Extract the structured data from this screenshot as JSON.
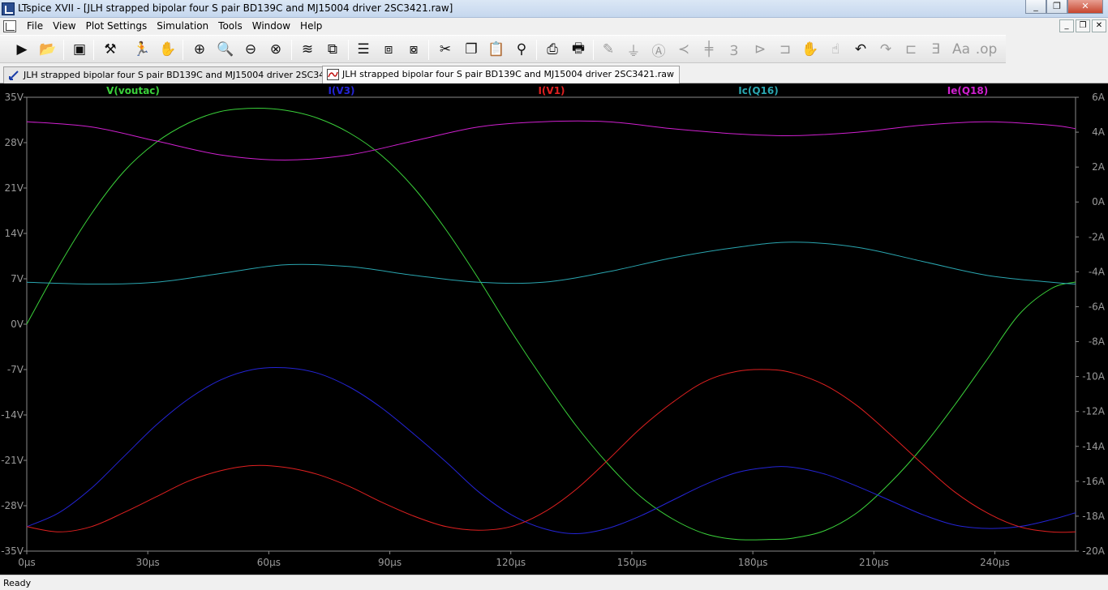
{
  "window": {
    "title": "LTspice XVII - [JLH strapped bipolar four S pair BD139C and  MJ15004 driver 2SC3421.raw]",
    "buttons": [
      "_",
      "❐",
      "✕"
    ]
  },
  "menu": {
    "items": [
      "File",
      "View",
      "Plot Settings",
      "Simulation",
      "Tools",
      "Window",
      "Help"
    ],
    "mdi_buttons": [
      "_",
      "❐",
      "✕"
    ]
  },
  "toolbar": {
    "icons": [
      "run-icon",
      "open-icon",
      "save-icon",
      "control-panel-icon",
      "run-man-icon",
      "pan-hand-icon",
      "zoom-in-icon",
      "zoom-fit-icon",
      "zoom-out-icon",
      "zoom-cancel-icon",
      "autorange-icon",
      "plot-traces-icon",
      "tile-horizontal-icon",
      "cascade-icon",
      "tile-vertical-icon",
      "cut-icon",
      "copy-icon",
      "paste-icon",
      "find-icon",
      "print-icon",
      "print-setup-icon",
      "wire-icon",
      "ground-icon",
      "label-icon",
      "resistor-icon",
      "capacitor-icon",
      "inductor-icon",
      "diode-icon",
      "component-icon",
      "move-icon",
      "drag-icon",
      "undo-icon",
      "redo-icon",
      "rotate-icon",
      "mirror-icon",
      "text-icon",
      "spice-directive-icon"
    ]
  },
  "tabs": [
    {
      "label": "JLH strapped bipolar four S pair BD139C and  MJ15004 driver 2SC3421.asc",
      "active": false
    },
    {
      "label": "JLH strapped bipolar four S pair BD139C and  MJ15004 driver 2SC3421.raw",
      "active": true
    }
  ],
  "status": {
    "text": "Ready"
  },
  "chart_data": {
    "type": "line",
    "x_unit": "µs",
    "xlim": [
      0,
      260
    ],
    "x_ticks": [
      "0µs",
      "30µs",
      "60µs",
      "90µs",
      "120µs",
      "150µs",
      "180µs",
      "210µs",
      "240µs"
    ],
    "x_tick_values": [
      0,
      30,
      60,
      90,
      120,
      150,
      180,
      210,
      240
    ],
    "left_axis": {
      "unit": "V",
      "ylim": [
        -35,
        35
      ],
      "ticks": [
        "35V",
        "28V",
        "21V",
        "14V",
        "7V",
        "0V",
        "-7V",
        "-14V",
        "-21V",
        "-28V",
        "-35V"
      ],
      "tick_values": [
        35,
        28,
        21,
        14,
        7,
        0,
        -7,
        -14,
        -21,
        -28,
        -35
      ]
    },
    "right_axis": {
      "unit": "A",
      "ylim": [
        -20,
        6
      ],
      "ticks": [
        "6A",
        "4A",
        "2A",
        "0A",
        "-2A",
        "-4A",
        "-6A",
        "-8A",
        "-10A",
        "-12A",
        "-14A",
        "-16A",
        "-18A",
        "-20A"
      ],
      "tick_values": [
        6,
        4,
        2,
        0,
        -2,
        -4,
        -6,
        -8,
        -10,
        -12,
        -14,
        -16,
        -18,
        -20
      ]
    },
    "grid": false,
    "legend": "top",
    "series": [
      {
        "name": "V(voutac)",
        "color": "#3ad13a",
        "axis": "left",
        "x": [
          0,
          8,
          16,
          24,
          32,
          40,
          48,
          56,
          64,
          72,
          80,
          88,
          96,
          104,
          112,
          120,
          128,
          136,
          144,
          152,
          160,
          168,
          176,
          184,
          190,
          198,
          206,
          214,
          222,
          230,
          238,
          246,
          254,
          260
        ],
        "y": [
          0,
          9,
          17,
          23.5,
          28,
          31,
          32.8,
          33.3,
          33,
          31.8,
          29.5,
          26,
          21,
          14.5,
          7,
          -1,
          -8.5,
          -15.5,
          -21.5,
          -26.5,
          -30,
          -32.3,
          -33.2,
          -33.2,
          -33,
          -31.8,
          -29,
          -24.5,
          -19,
          -12.5,
          -5.5,
          1.5,
          5.5,
          6.5
        ]
      },
      {
        "name": "I(V3)",
        "color": "#2424d6",
        "axis": "right",
        "x": [
          0,
          8,
          16,
          24,
          32,
          40,
          48,
          56,
          64,
          72,
          80,
          88,
          96,
          104,
          112,
          120,
          128,
          136,
          144,
          152,
          160,
          168,
          176,
          184,
          190,
          198,
          206,
          214,
          222,
          230,
          238,
          246,
          254,
          260
        ],
        "y": [
          -18.6,
          -17.8,
          -16.4,
          -14.6,
          -12.8,
          -11.3,
          -10.2,
          -9.6,
          -9.5,
          -9.8,
          -10.6,
          -11.8,
          -13.3,
          -14.9,
          -16.6,
          -17.9,
          -18.7,
          -19.0,
          -18.7,
          -18.0,
          -17.1,
          -16.2,
          -15.5,
          -15.2,
          -15.2,
          -15.6,
          -16.3,
          -17.1,
          -17.9,
          -18.5,
          -18.7,
          -18.6,
          -18.2,
          -17.8
        ]
      },
      {
        "name": "I(V1)",
        "color": "#e02020",
        "axis": "right",
        "x": [
          0,
          8,
          16,
          24,
          32,
          40,
          48,
          56,
          64,
          72,
          80,
          88,
          96,
          104,
          112,
          120,
          128,
          136,
          144,
          152,
          160,
          168,
          176,
          184,
          190,
          198,
          206,
          214,
          222,
          230,
          238,
          246,
          254,
          260
        ],
        "y": [
          -18.6,
          -18.9,
          -18.6,
          -17.8,
          -16.9,
          -16.0,
          -15.4,
          -15.1,
          -15.2,
          -15.6,
          -16.3,
          -17.2,
          -18.0,
          -18.6,
          -18.8,
          -18.6,
          -17.8,
          -16.5,
          -14.8,
          -13.0,
          -11.5,
          -10.3,
          -9.7,
          -9.6,
          -9.8,
          -10.5,
          -11.7,
          -13.3,
          -15.0,
          -16.6,
          -17.8,
          -18.6,
          -18.9,
          -18.9
        ]
      },
      {
        "name": "Ic(Q16)",
        "color": "#2aa6b0",
        "axis": "right",
        "x": [
          0,
          16,
          32,
          48,
          64,
          80,
          96,
          112,
          128,
          144,
          160,
          176,
          190,
          206,
          222,
          238,
          254,
          260
        ],
        "y": [
          -4.6,
          -4.7,
          -4.6,
          -4.1,
          -3.6,
          -3.7,
          -4.2,
          -4.6,
          -4.6,
          -4.0,
          -3.2,
          -2.6,
          -2.3,
          -2.6,
          -3.4,
          -4.2,
          -4.6,
          -4.7
        ]
      },
      {
        "name": "Ie(Q18)",
        "color": "#d020d0",
        "axis": "right",
        "x": [
          0,
          16,
          32,
          48,
          64,
          80,
          96,
          112,
          128,
          144,
          160,
          176,
          190,
          206,
          222,
          238,
          254,
          260
        ],
        "y": [
          4.6,
          4.3,
          3.5,
          2.7,
          2.4,
          2.7,
          3.5,
          4.3,
          4.6,
          4.6,
          4.2,
          3.9,
          3.8,
          4.0,
          4.4,
          4.6,
          4.4,
          4.2
        ]
      }
    ]
  }
}
